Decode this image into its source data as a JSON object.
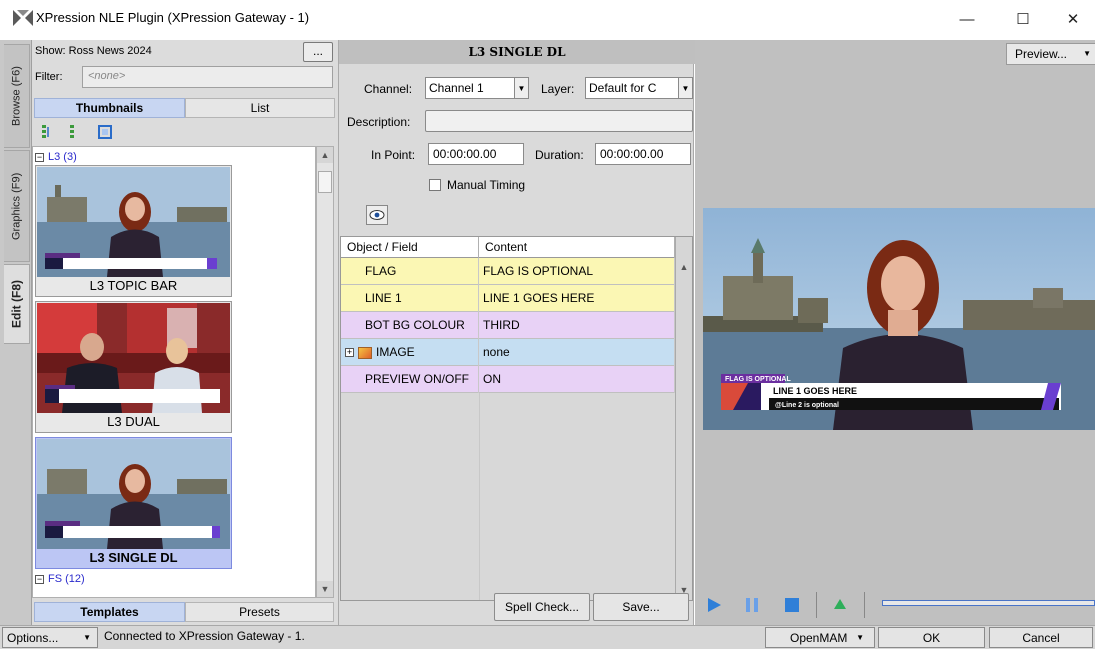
{
  "window": {
    "title": "XPression NLE Plugin (XPression Gateway - 1)",
    "minimize": "—",
    "maximize": "☐",
    "close": "✕"
  },
  "vertical_tabs": [
    {
      "label": "Browse (F6)",
      "active": false
    },
    {
      "label": "Graphics (F9)",
      "active": false
    },
    {
      "label": "Edit (F8)",
      "active": true
    }
  ],
  "left": {
    "show_label": "Show: Ross News 2024",
    "show_button": "...",
    "filter_label": "Filter:",
    "filter_value": "<none>",
    "view_tabs": [
      "Thumbnails",
      "List"
    ],
    "groups": [
      {
        "label": "L3 (3)",
        "toggle": "−"
      },
      {
        "label": "FS (12)",
        "toggle": "−"
      }
    ],
    "thumbnails": [
      {
        "label": "L3 TOPIC BAR",
        "selected": false
      },
      {
        "label": "L3 DUAL",
        "selected": false
      },
      {
        "label": "L3 SINGLE DL",
        "selected": true
      }
    ],
    "bottom_tabs": [
      "Templates",
      "Presets"
    ]
  },
  "mid": {
    "header": "L3 SINGLE DL",
    "channel_label": "Channel:",
    "channel_value": "Channel 1",
    "layer_label": "Layer:",
    "layer_value": "Default for C",
    "description_label": "Description:",
    "description_value": "",
    "inpoint_label": "In Point:",
    "inpoint_value": "00:00:00.00",
    "duration_label": "Duration:",
    "duration_value": "00:00:00.00",
    "manual_timing_label": "Manual Timing",
    "grid_headers": [
      "Object / Field",
      "Content"
    ],
    "rows": [
      {
        "field": "FLAG",
        "content": "FLAG IS OPTIONAL",
        "color": "#fbf7b4"
      },
      {
        "field": "LINE 1",
        "content": "LINE 1 GOES HERE",
        "color": "#fbf7b4"
      },
      {
        "field": "BOT BG COLOUR",
        "content": "THIRD",
        "color": "#e8d2f6"
      },
      {
        "field": "IMAGE",
        "content": "none",
        "color": "#c5def2"
      },
      {
        "field": "PREVIEW ON/OFF",
        "content": "ON",
        "color": "#e8d2f6"
      }
    ],
    "spell_check": "Spell Check...",
    "save": "Save..."
  },
  "right": {
    "preview_button": "Preview...",
    "lower_third": {
      "flag": "FLAG IS OPTIONAL",
      "line1": "LINE 1 GOES HERE",
      "line2": "@Line 2 is optional"
    }
  },
  "status": {
    "options_button": "Options...",
    "text": "Connected to XPression Gateway - 1.",
    "openmam": "OpenMAM",
    "ok": "OK",
    "cancel": "Cancel"
  },
  "colors": {
    "accent": "#2f7fd8",
    "selected_thumb": "#bcc6f4",
    "tab_active": "#c8d6f2"
  }
}
